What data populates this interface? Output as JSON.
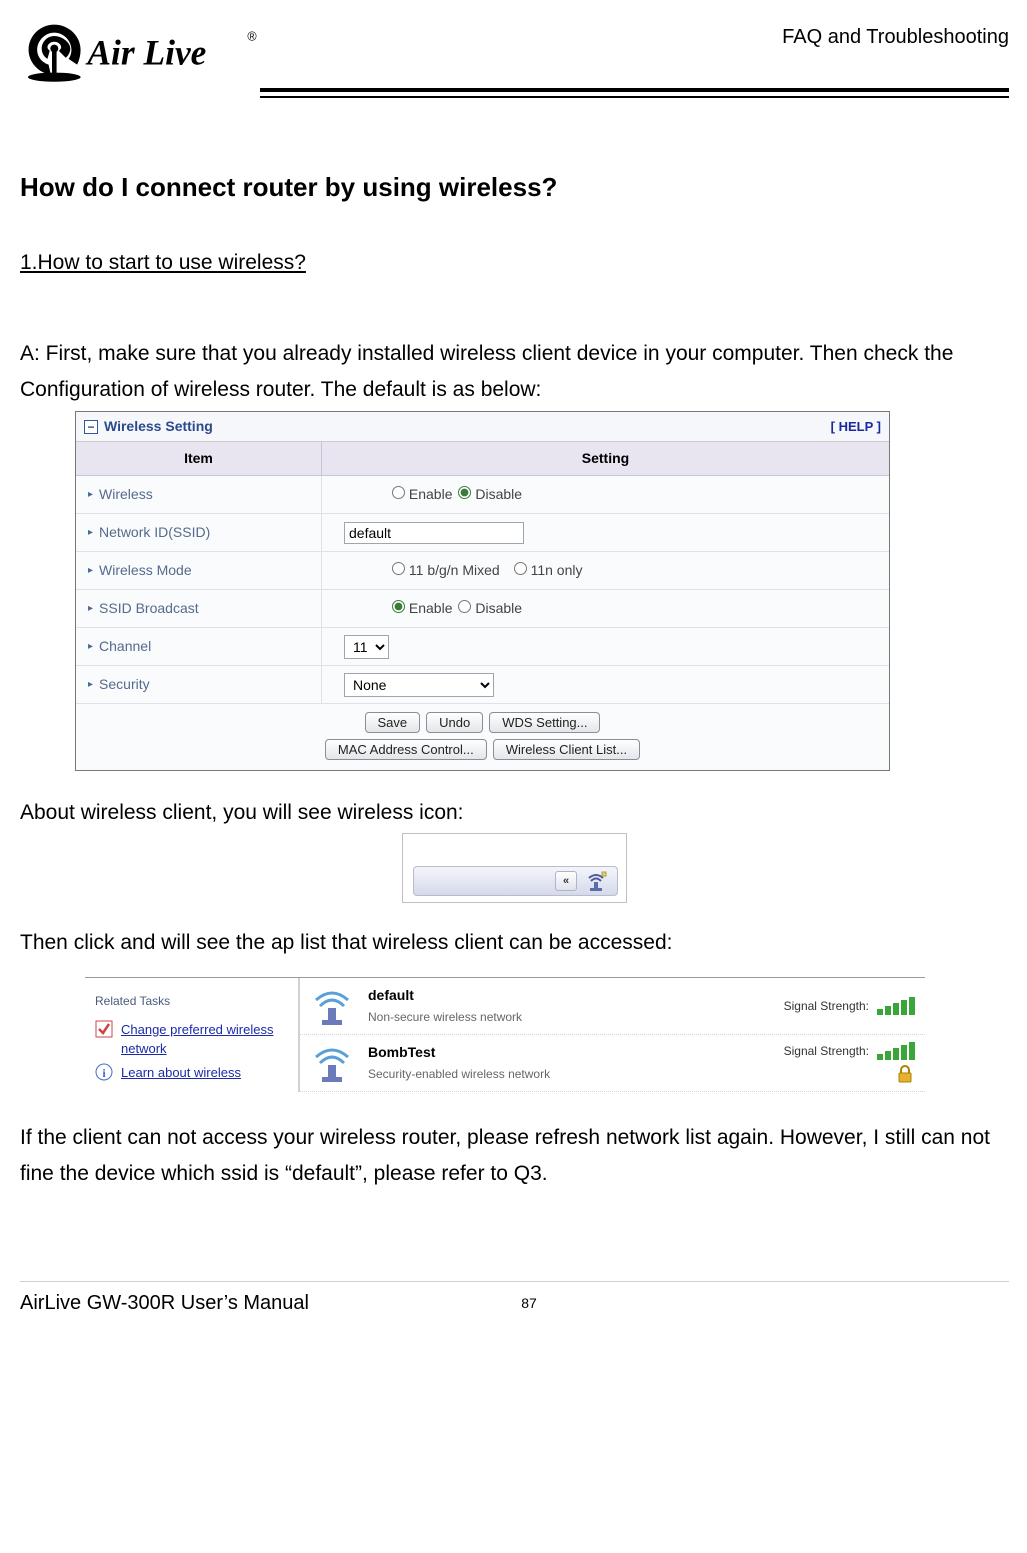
{
  "header": {
    "brand_text": "Air Live",
    "brand_trademark": "®",
    "breadcrumb": "FAQ and Troubleshooting"
  },
  "main": {
    "title": "How do I connect router by using wireless?",
    "question": "1.How to start to use wireless?",
    "answer_p1": "A: First, make sure that you already installed wireless client device in your computer. Then check the Configuration of wireless router. The default is as below:",
    "answer_p2": "About wireless client, you will see wireless icon:",
    "answer_p3": "Then click and will see the ap list that wireless client can be accessed:",
    "answer_p4": "If the client can not access your wireless router, please refresh network list again. However, I still can not fine the device which ssid is “default”, please refer to Q3."
  },
  "panel": {
    "title": "Wireless Setting",
    "help": "[ HELP ]",
    "col_item": "Item",
    "col_setting": "Setting",
    "rows": {
      "wireless": {
        "label": "Wireless",
        "opt1": "Enable",
        "opt2": "Disable"
      },
      "ssid": {
        "label": "Network ID(SSID)",
        "value": "default"
      },
      "mode": {
        "label": "Wireless Mode",
        "opt1": "11 b/g/n Mixed",
        "opt2": "11n only"
      },
      "broadcast": {
        "label": "SSID Broadcast",
        "opt1": "Enable",
        "opt2": "Disable"
      },
      "channel": {
        "label": "Channel",
        "value": "11"
      },
      "security": {
        "label": "Security",
        "value": "None"
      }
    },
    "buttons": {
      "save": "Save",
      "undo": "Undo",
      "wds": "WDS Setting...",
      "mac": "MAC Address Control...",
      "clients": "Wireless Client List..."
    }
  },
  "wifi_list": {
    "related_tasks_title": "Related Tasks",
    "task1": "Change preferred wireless network",
    "task2": "Learn about wireless",
    "signal_label": "Signal Strength:",
    "networks": [
      {
        "name": "default",
        "desc": "Non-secure wireless network",
        "secured": false
      },
      {
        "name": "BombTest",
        "desc": "Security-enabled wireless network",
        "secured": true
      }
    ]
  },
  "footer": {
    "manual": "AirLive GW-300R User’s Manual",
    "page": "87"
  }
}
